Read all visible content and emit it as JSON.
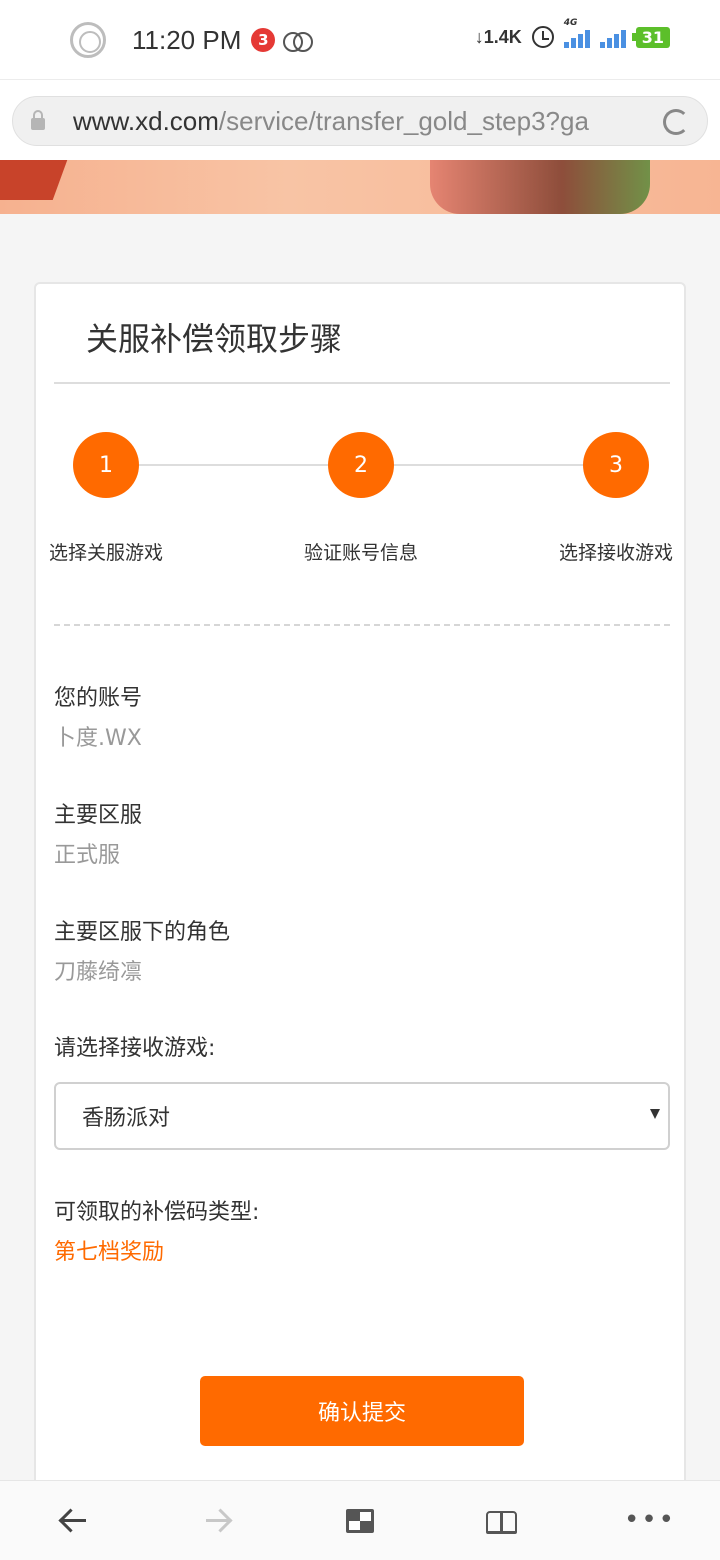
{
  "status_bar": {
    "time": "11:20 PM",
    "notification_count": "3",
    "net_speed": "1.4K",
    "signal1_tag": "4G",
    "battery": "31"
  },
  "browser": {
    "url_domain": "www.xd.com",
    "url_path": "/service/transfer_gold_step3?ga"
  },
  "page": {
    "title": "关服补偿领取步骤",
    "steps": [
      {
        "number": "1",
        "label": "选择关服游戏"
      },
      {
        "number": "2",
        "label": "验证账号信息"
      },
      {
        "number": "3",
        "label": "选择接收游戏"
      }
    ],
    "fields": {
      "account_label": "您的账号",
      "account_value": "卜度.WX",
      "server_label": "主要区服",
      "server_value": "正式服",
      "role_label": "主要区服下的角色",
      "role_value": "刀藤绮凛",
      "select_label": "请选择接收游戏:",
      "select_value": "香肠派对",
      "reward_label": "可领取的补偿码类型:",
      "reward_value": "第七档奖励"
    },
    "submit_label": "确认提交"
  },
  "colors": {
    "accent": "#ff6a00"
  }
}
